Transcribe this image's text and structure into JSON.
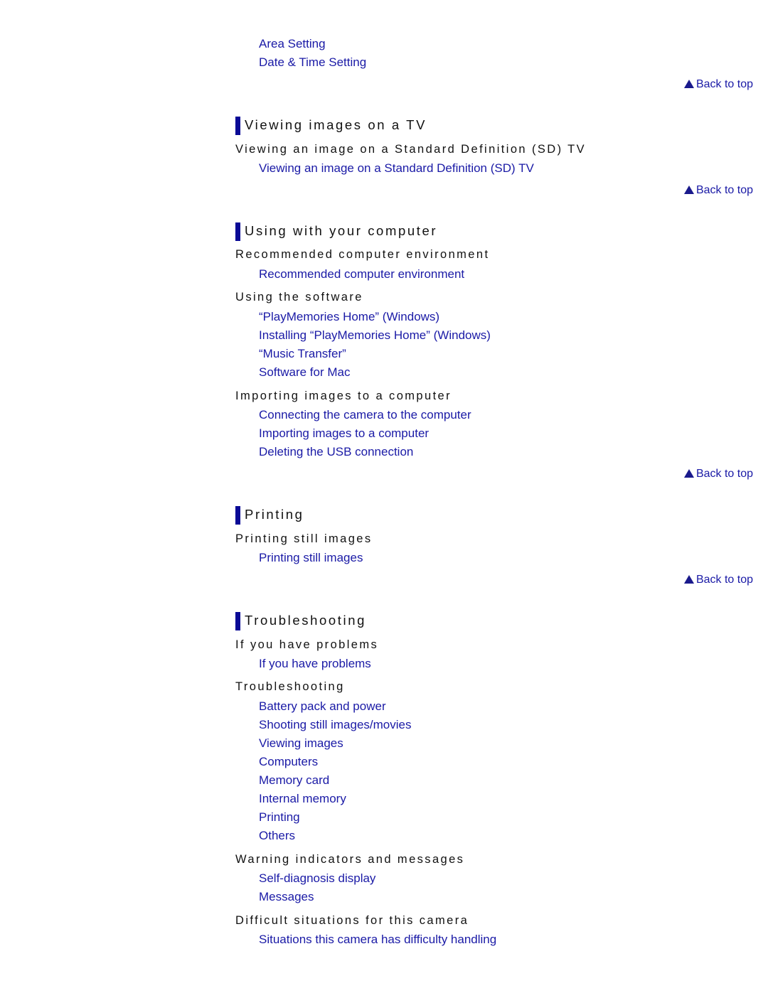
{
  "back_to_top_label": "Back to top",
  "colors": {
    "link": "#1a1aa6",
    "heading_bar": "#0a0a96",
    "text": "#111111"
  },
  "top_links": [
    "Area Setting",
    "Date & Time Setting"
  ],
  "sections": [
    {
      "title": "Viewing images on a TV",
      "groups": [
        {
          "heading": "Viewing an image on a Standard Definition (SD) TV",
          "links": [
            "Viewing an image on a Standard Definition (SD) TV"
          ]
        }
      ]
    },
    {
      "title": "Using with your computer",
      "groups": [
        {
          "heading": "Recommended computer environment",
          "links": [
            "Recommended computer environment"
          ]
        },
        {
          "heading": "Using the software",
          "links": [
            "“PlayMemories Home” (Windows)",
            "Installing “PlayMemories Home” (Windows)",
            "“Music Transfer”",
            "Software for Mac"
          ]
        },
        {
          "heading": "Importing images to a computer",
          "links": [
            "Connecting the camera to the computer",
            "Importing images to a computer",
            "Deleting the USB connection"
          ]
        }
      ]
    },
    {
      "title": "Printing",
      "groups": [
        {
          "heading": "Printing still images",
          "links": [
            "Printing still images"
          ]
        }
      ]
    },
    {
      "title": "Troubleshooting",
      "groups": [
        {
          "heading": "If you have problems",
          "links": [
            "If you have problems"
          ]
        },
        {
          "heading": "Troubleshooting",
          "links": [
            "Battery pack and power",
            "Shooting still images/movies",
            "Viewing images",
            "Computers",
            "Memory card",
            "Internal memory",
            "Printing",
            "Others"
          ]
        },
        {
          "heading": "Warning indicators and messages",
          "links": [
            "Self-diagnosis display",
            "Messages"
          ]
        },
        {
          "heading": "Difficult situations for this camera",
          "links": [
            "Situations this camera has difficulty handling"
          ]
        }
      ]
    }
  ]
}
